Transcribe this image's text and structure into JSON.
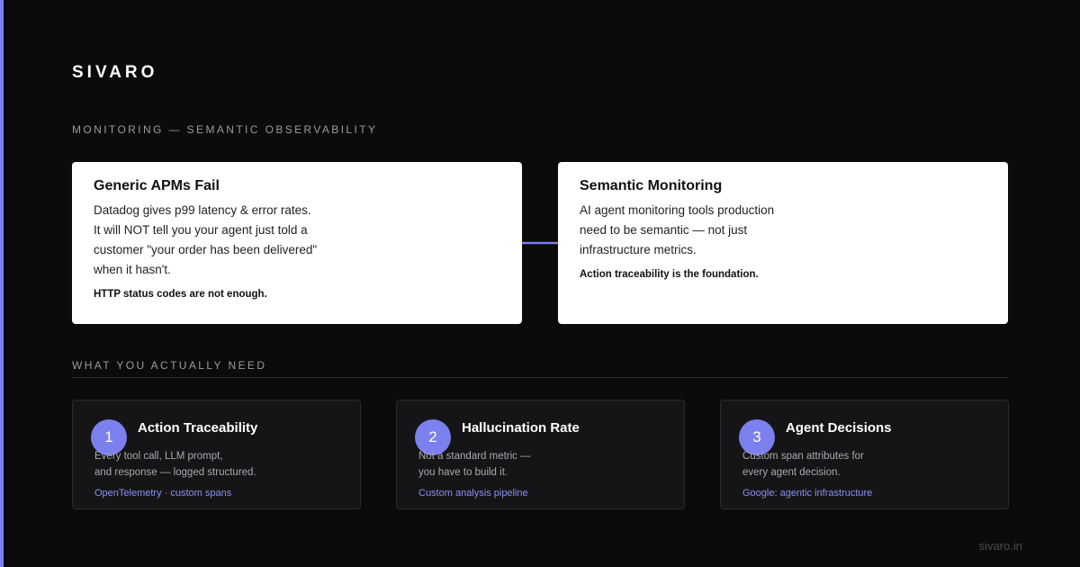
{
  "brand": "SIVARO",
  "colors": {
    "accent": "#7b80ee",
    "background": "#0b0b0c",
    "card": "#ffffff",
    "link": "#8a8ff2"
  },
  "section_top": "MONITORING — SEMANTIC OBSERVABILITY",
  "cards": [
    {
      "title": "Generic APMs Fail",
      "lines": [
        "Datadog gives p99 latency & error rates.",
        "It will NOT tell you your agent just told a",
        "customer \"your order has been delivered\"",
        "when it hasn't."
      ],
      "note": "HTTP status codes are not enough."
    },
    {
      "title": "Semantic Monitoring",
      "lines": [
        "AI agent monitoring tools production",
        "need to be semantic — not just",
        "infrastructure metrics."
      ],
      "note": "Action traceability is the foundation."
    }
  ],
  "connector_icon": "arrow-right-icon",
  "section_needs": "WHAT YOU ACTUALLY NEED",
  "needs": [
    {
      "number": "1",
      "title": "Action Traceability",
      "lines": [
        "Every tool call, LLM prompt,",
        "and response — logged structured."
      ],
      "link": "OpenTelemetry · custom spans"
    },
    {
      "number": "2",
      "title": "Hallucination Rate",
      "lines": [
        "Not a standard metric —",
        "you have to build it."
      ],
      "link": "Custom analysis pipeline"
    },
    {
      "number": "3",
      "title": "Agent Decisions",
      "lines": [
        "Custom span attributes for",
        "every agent decision."
      ],
      "link": "Google: agentic infrastructure"
    }
  ],
  "footer": "sivaro.in"
}
